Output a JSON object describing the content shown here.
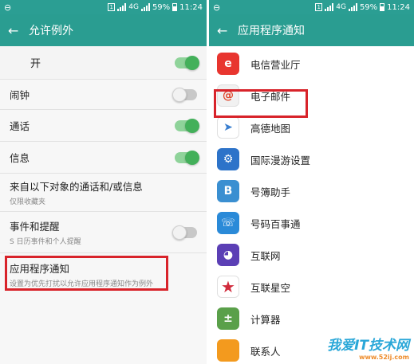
{
  "status": {
    "left_icon": "dnd-icon",
    "indicator": "4G",
    "battery": "59%",
    "time": "11:24"
  },
  "left": {
    "title": "允许例外",
    "master": {
      "label": "开",
      "on": true
    },
    "items": [
      {
        "title": "闹钟",
        "on": false
      },
      {
        "title": "通话",
        "on": true
      },
      {
        "title": "信息",
        "on": true
      },
      {
        "title": "来自以下对象的通话和/或信息",
        "subtitle": "仅限收藏夹"
      },
      {
        "title": "事件和提醒",
        "subtitle": "S 日历事件和个人提醒",
        "on": false
      },
      {
        "title": "应用程序通知",
        "subtitle": "设置为优先打扰以允许应用程序通知作为例外"
      }
    ],
    "highlight_color": "#d8232a"
  },
  "right": {
    "title": "应用程序通知",
    "apps": [
      {
        "name": "电信营业厅",
        "icon": "china-telecom-icon",
        "color": "#e8352f",
        "glyph": "e"
      },
      {
        "name": "电子邮件",
        "icon": "email-icon",
        "color": "#f1f1f1",
        "glyph": "@"
      },
      {
        "name": "高德地图",
        "icon": "amap-icon",
        "color": "#ffffff",
        "glyph": "➤"
      },
      {
        "name": "国际漫游设置",
        "icon": "roaming-icon",
        "color": "#2d73c9",
        "glyph": "⚙"
      },
      {
        "name": "号簿助手",
        "icon": "contacts-helper-icon",
        "color": "#3a8fd1",
        "glyph": "B"
      },
      {
        "name": "号码百事通",
        "icon": "number-service-icon",
        "color": "#2a8ad8",
        "glyph": "☏"
      },
      {
        "name": "互联网",
        "icon": "internet-icon",
        "color": "#5b3fb5",
        "glyph": "◕"
      },
      {
        "name": "互联星空",
        "icon": "star-icon",
        "color": "#ffffff",
        "glyph": "★"
      },
      {
        "name": "计算器",
        "icon": "calculator-icon",
        "color": "#5aa04a",
        "glyph": "±"
      },
      {
        "name": "联系人",
        "icon": "contacts-icon",
        "color": "#f39a1e",
        "glyph": ""
      }
    ]
  },
  "watermark": {
    "main": "我爱IT技术网",
    "url": "www.52ij.com"
  }
}
